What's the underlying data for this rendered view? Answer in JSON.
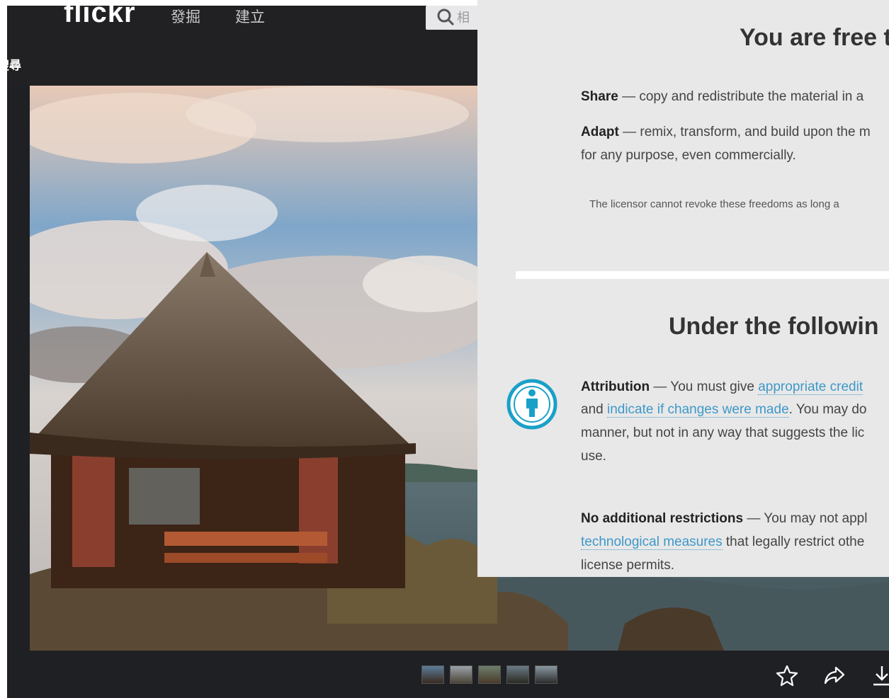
{
  "flickr": {
    "logo": "flickr",
    "nav": [
      "發掘",
      "建立"
    ],
    "search_placeholder": "相",
    "back_label": "搜尋",
    "thumbnail_count": 5,
    "actions": [
      "star-icon",
      "share-icon",
      "download-icon"
    ]
  },
  "license": {
    "heading_free": "You are free t",
    "share_term": "Share",
    "share_text": " — copy and redistribute the material in a",
    "adapt_term": "Adapt",
    "adapt_text": " — remix, transform, and build upon the m",
    "adapt_line2": "for any purpose, even commercially.",
    "note": "The licensor cannot revoke these freedoms as long a",
    "heading_conditions": "Under the followin",
    "attribution_term": "Attribution",
    "attribution_text1": " — You must give ",
    "attribution_link1": "appropriate credit",
    "attribution_and": "and ",
    "attribution_link2": "indicate if changes were made",
    "attribution_text2": ". You may do",
    "attribution_line3": "manner, but not in any way that suggests the lic",
    "attribution_line4": "use.",
    "norestrict_term": "No additional restrictions",
    "norestrict_text": " — You may not appl",
    "norestrict_link": "technological measures",
    "norestrict_text2": " that legally restrict othe",
    "norestrict_line3": "license permits."
  },
  "colors": {
    "flickr_bg": "#1f2024",
    "overlay_bg": "#e8e8e8",
    "link": "#3e98c9",
    "attribution_icon": "#1aa0c8"
  }
}
